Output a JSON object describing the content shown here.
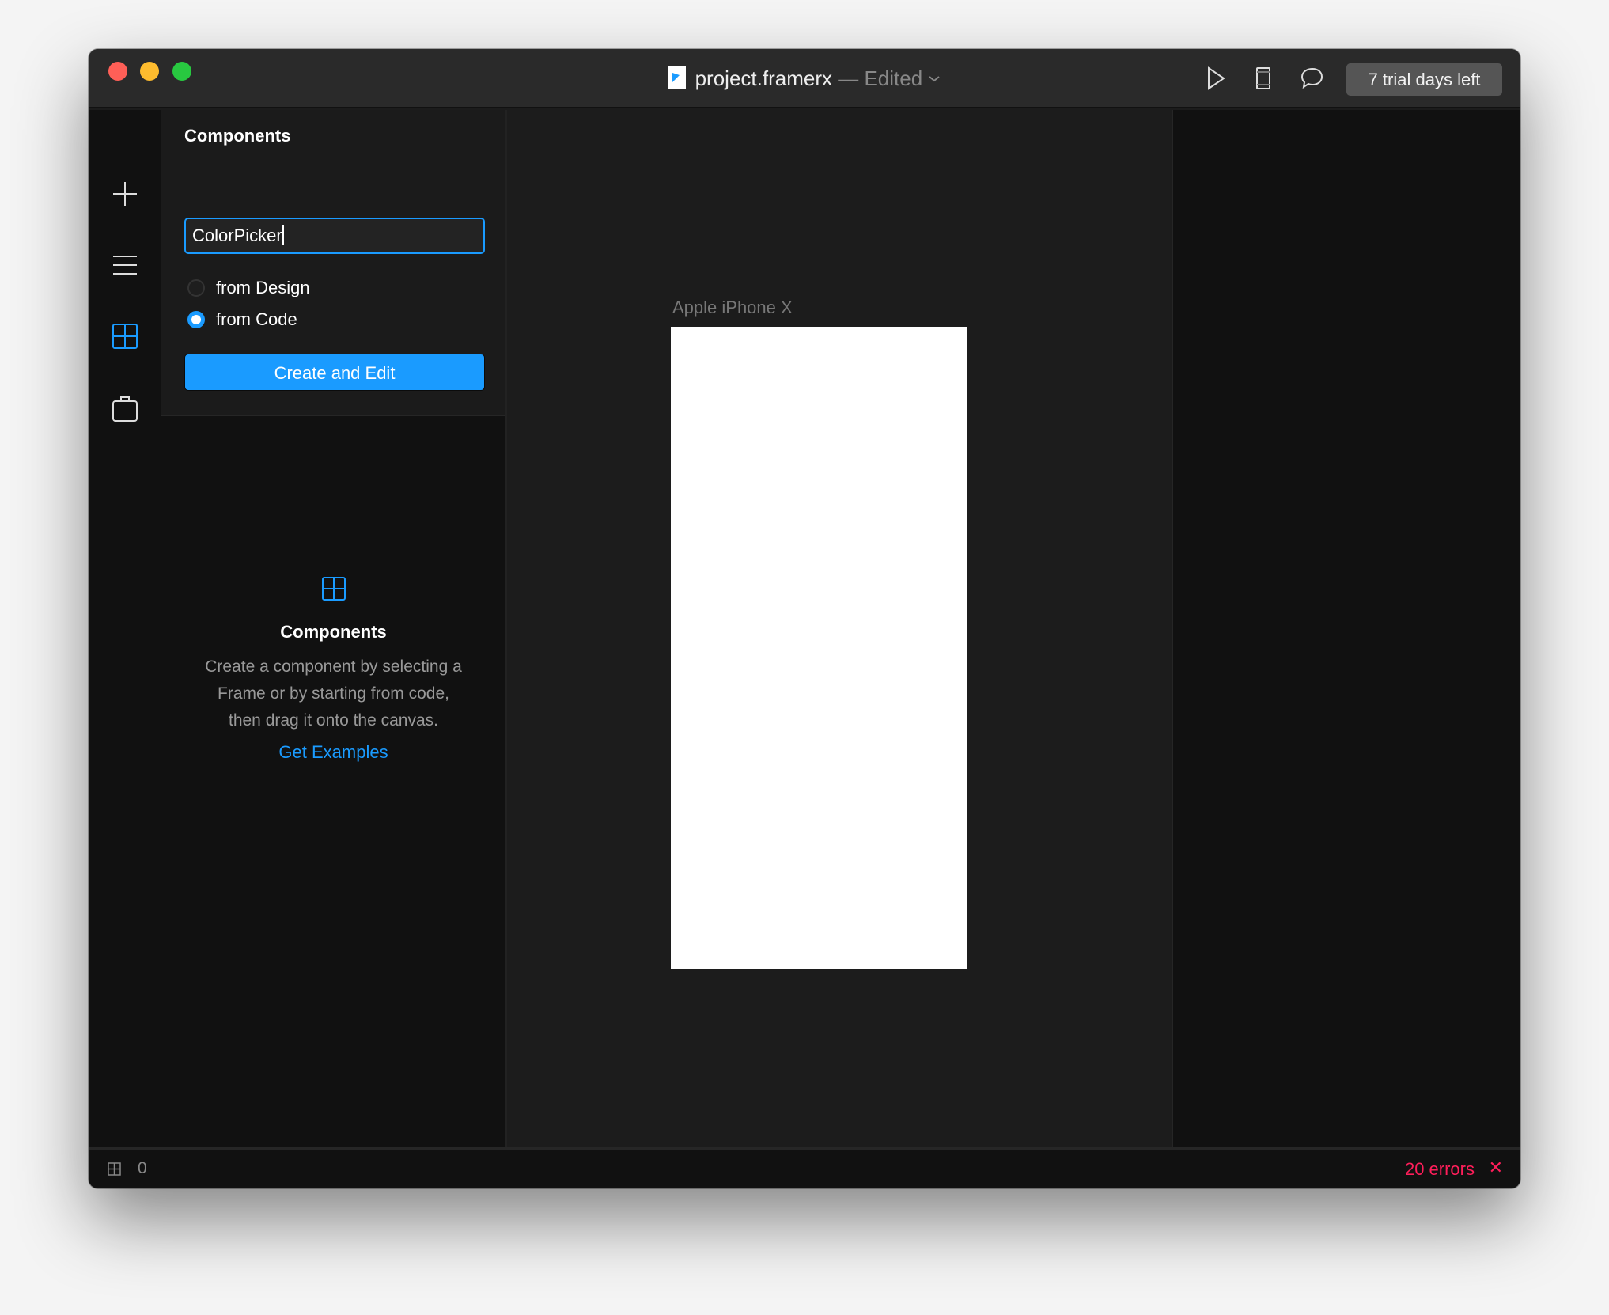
{
  "window": {
    "file_name": "project.framerx",
    "edited_label": "— Edited",
    "trial_badge": "7 trial days left"
  },
  "toolbar": {
    "icons": [
      "play-icon",
      "device-icon",
      "comment-icon"
    ]
  },
  "rail": {
    "icons": [
      "plus-icon",
      "menu-icon",
      "components-icon",
      "store-icon"
    ],
    "active": "components-icon"
  },
  "panel": {
    "title": "Components",
    "name_input": {
      "value": "ColorPicker"
    },
    "options": [
      {
        "label": "from Design",
        "selected": false
      },
      {
        "label": "from Code",
        "selected": true
      }
    ],
    "create_button": "Create and Edit",
    "empty_state": {
      "title": "Components",
      "description": [
        "Create a component by selecting a",
        "Frame or by starting from code,",
        "then drag it onto the canvas."
      ],
      "link": "Get Examples"
    }
  },
  "canvas": {
    "frame_label": "Apple iPhone X"
  },
  "status": {
    "component_count": "0",
    "errors": "20 errors"
  },
  "colors": {
    "accent": "#1a9bff",
    "error": "#ff1e5a"
  }
}
